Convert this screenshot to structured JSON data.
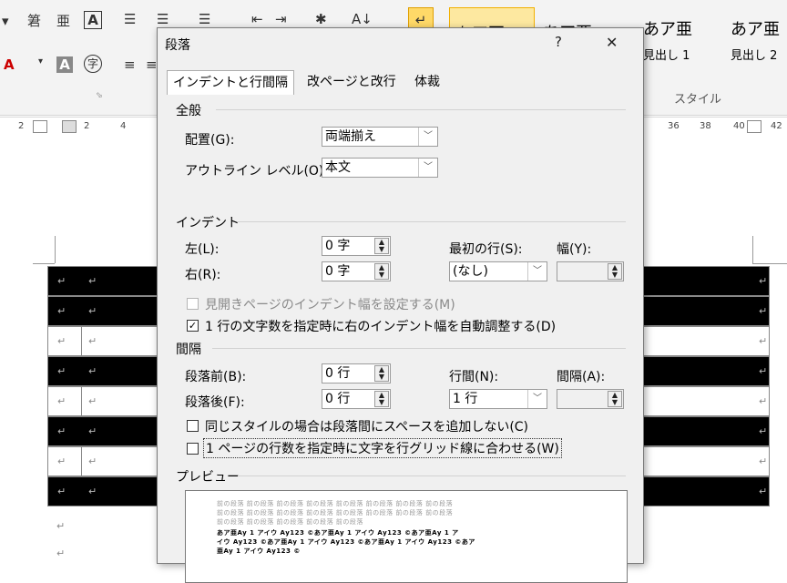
{
  "ribbon": {
    "icon_chars": [
      "▾",
      "AA",
      "A",
      "≔",
      "≔",
      "≔",
      "⇤",
      "⇥",
      "✱",
      "¶",
      "↵"
    ],
    "styles": [
      {
        "big": "あア亜",
        "small": ""
      },
      {
        "big": "あア亜",
        "small": ""
      },
      {
        "big": "あア亜",
        "small": "見出し 1"
      },
      {
        "big": "あア亜",
        "small": "見出し 2"
      }
    ],
    "group_label": "スタイル"
  },
  "ruler": {
    "left_ticks": [
      "2",
      "2",
      "4"
    ],
    "right_ticks": [
      "36",
      "38",
      "40",
      "42"
    ]
  },
  "document": {
    "para_mark": "↵"
  },
  "dialog": {
    "title": "段落",
    "help": "?",
    "close": "✕",
    "tabs": [
      "インデントと行間隔",
      "改ページと改行",
      "体裁"
    ],
    "general": {
      "heading": "全般",
      "alignment_label": "配置(G):",
      "alignment_value": "両端揃え",
      "outline_label": "アウトライン レベル(O):",
      "outline_value": "本文"
    },
    "indent": {
      "heading": "インデント",
      "left_label": "左(L):",
      "left_value": "0 字",
      "right_label": "右(R):",
      "right_value": "0 字",
      "first_line_label": "最初の行(S):",
      "first_line_value": "(なし)",
      "width_label": "幅(Y):",
      "width_value": "",
      "mirror_label": "見開きページのインデント幅を設定する(M)",
      "auto_adjust_label": "1 行の文字数を指定時に右のインデント幅を自動調整する(D)"
    },
    "spacing": {
      "heading": "間隔",
      "before_label": "段落前(B):",
      "before_value": "0 行",
      "after_label": "段落後(F):",
      "after_value": "0 行",
      "line_spacing_label": "行間(N):",
      "line_spacing_value": "1 行",
      "at_label": "間隔(A):",
      "at_value": "",
      "no_space_same_style_label": "同じスタイルの場合は段落間にスペースを追加しない(C)",
      "snap_grid_label": "1 ページの行数を指定時に文字を行グリッド線に合わせる(W)"
    },
    "preview": {
      "heading": "プレビュー",
      "lines": [
        "前の段落 前の段落 前の段落 前の段落 前の段落 前の段落 前の段落 前の段落",
        "前の段落 前の段落 前の段落 前の段落 前の段落 前の段落 前の段落 前の段落",
        "前の段落 前の段落 前の段落 前の段落 前の段落",
        "あア亜Ay 1 アイウ Ay123 ©あア亜Ay 1 アイウ Ay123 ©あア亜Ay 1 ア",
        "イウ Ay123 ©あア亜Ay 1 アイウ Ay123 ©あア亜Ay 1 アイウ Ay123 ©あア",
        "亜Ay 1 アイウ Ay123 ©"
      ]
    }
  }
}
